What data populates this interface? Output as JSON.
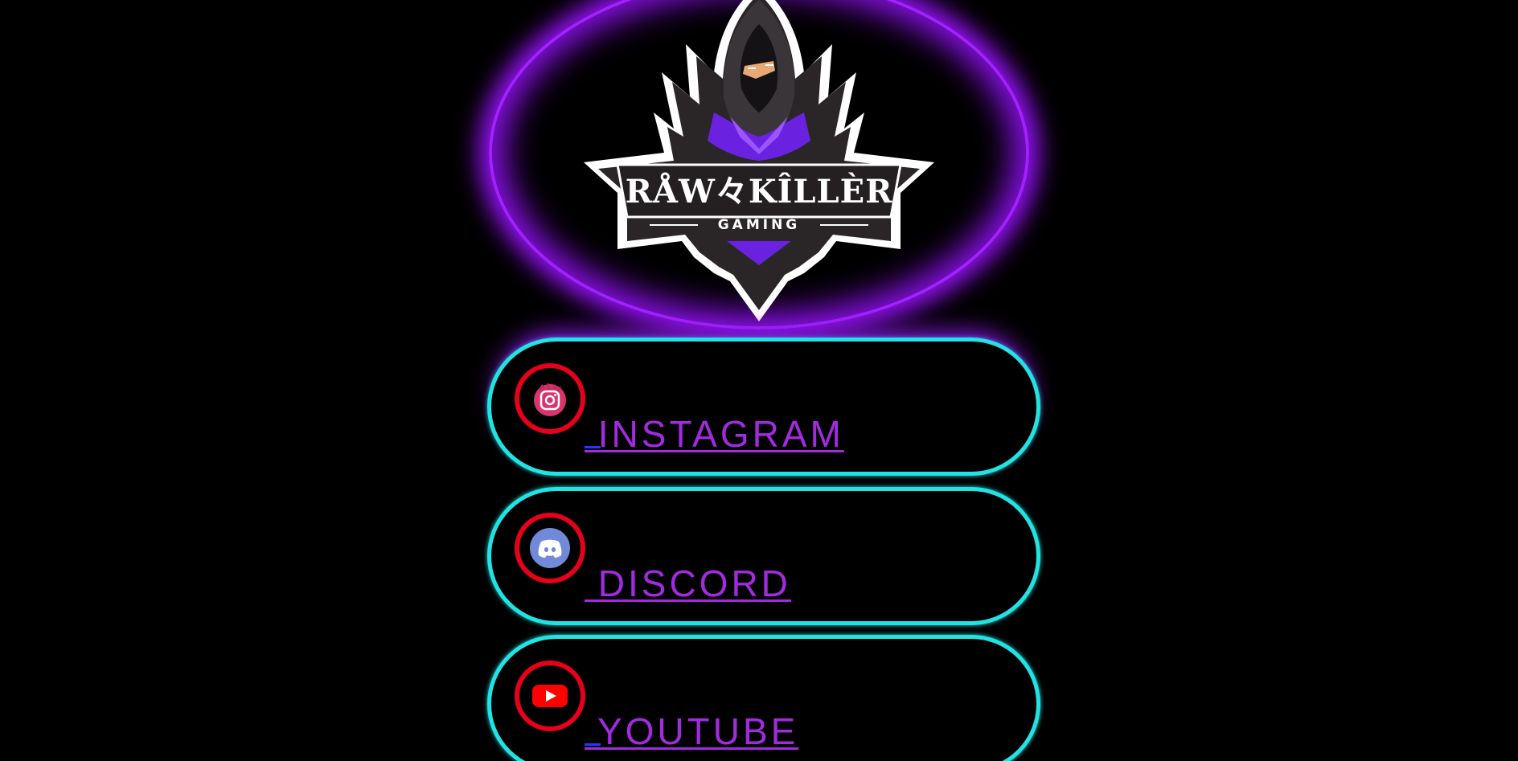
{
  "logo": {
    "title_text": "RÅW々KÎLLÈR",
    "subtitle_text": "GAMING",
    "ring_color": "#a321ff",
    "hood_accent": "#7a2cff"
  },
  "links": [
    {
      "label": " INSTAGRAM",
      "icon": "instagram-icon"
    },
    {
      "label": " DISCORD",
      "icon": "discord-icon"
    },
    {
      "label": " YOUTUBE",
      "icon": "youtube-icon"
    }
  ],
  "colors": {
    "background": "#000000",
    "pill_border": "#22e3e3",
    "icon_ring": "#e8001a",
    "link_text": "#a22ae0"
  }
}
